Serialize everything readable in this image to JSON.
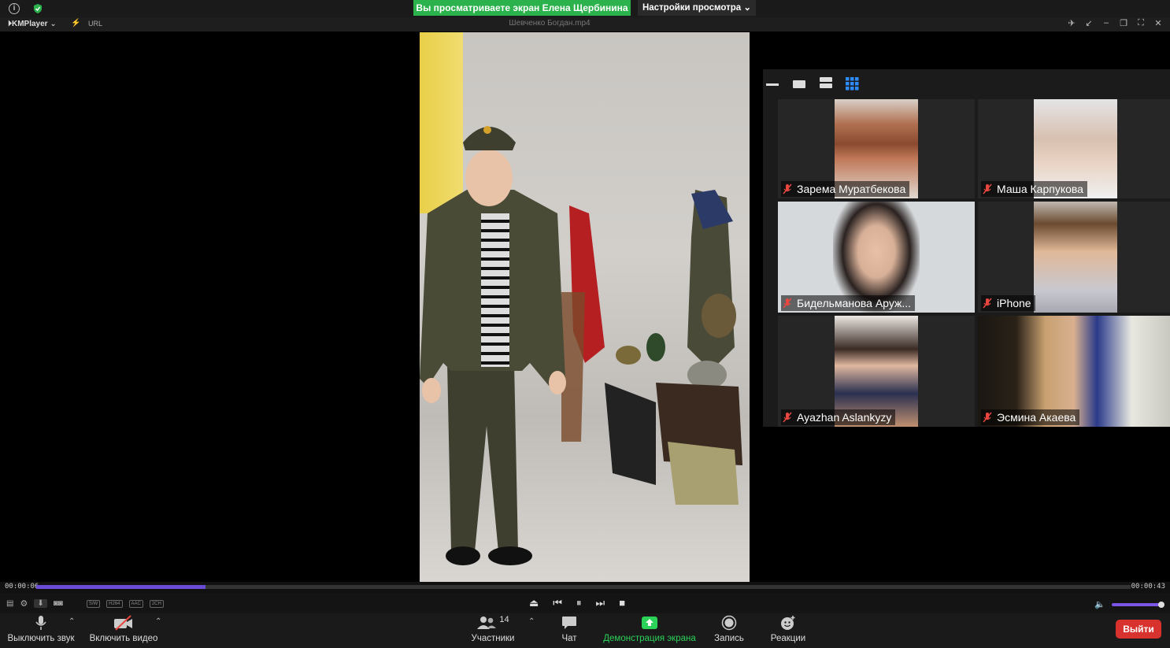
{
  "zoom_top": {
    "share_banner": "Вы просматриваете экран Елена Щербинина",
    "view_settings": "Настройки просмотра"
  },
  "kmplayer": {
    "logo": "KMPlayer",
    "url_label": "URL",
    "filename": "Шевченко Богдан.mp4",
    "time_elapsed": "00:00:06",
    "time_total": "00:00:43",
    "progress": 0.155,
    "volume": 0.95,
    "badges": [
      "S/W",
      "H264",
      "AAC",
      "2CH"
    ]
  },
  "gallery": {
    "participants": [
      {
        "name": "Зарема Муратбекова",
        "muted": true
      },
      {
        "name": "Маша Карпукова",
        "muted": true
      },
      {
        "name": "Бидельманова Аруж...",
        "muted": true
      },
      {
        "name": "iPhone",
        "muted": true
      },
      {
        "name": "Ayazhan Aslankyzy",
        "muted": true
      },
      {
        "name": "Эсмина Акаева",
        "muted": true
      }
    ]
  },
  "zoom_bottom": {
    "mute_label": "Выключить звук",
    "video_label": "Включить видео",
    "participants_label": "Участники",
    "participants_count": "14",
    "chat_label": "Чат",
    "share_label": "Демонстрация экрана",
    "record_label": "Запись",
    "reactions_label": "Реакции",
    "leave_label": "Выйти"
  },
  "colors": {
    "share_green": "#2bb24c",
    "seek_purple": "#6a4bd6",
    "leave_red": "#d8322f"
  }
}
